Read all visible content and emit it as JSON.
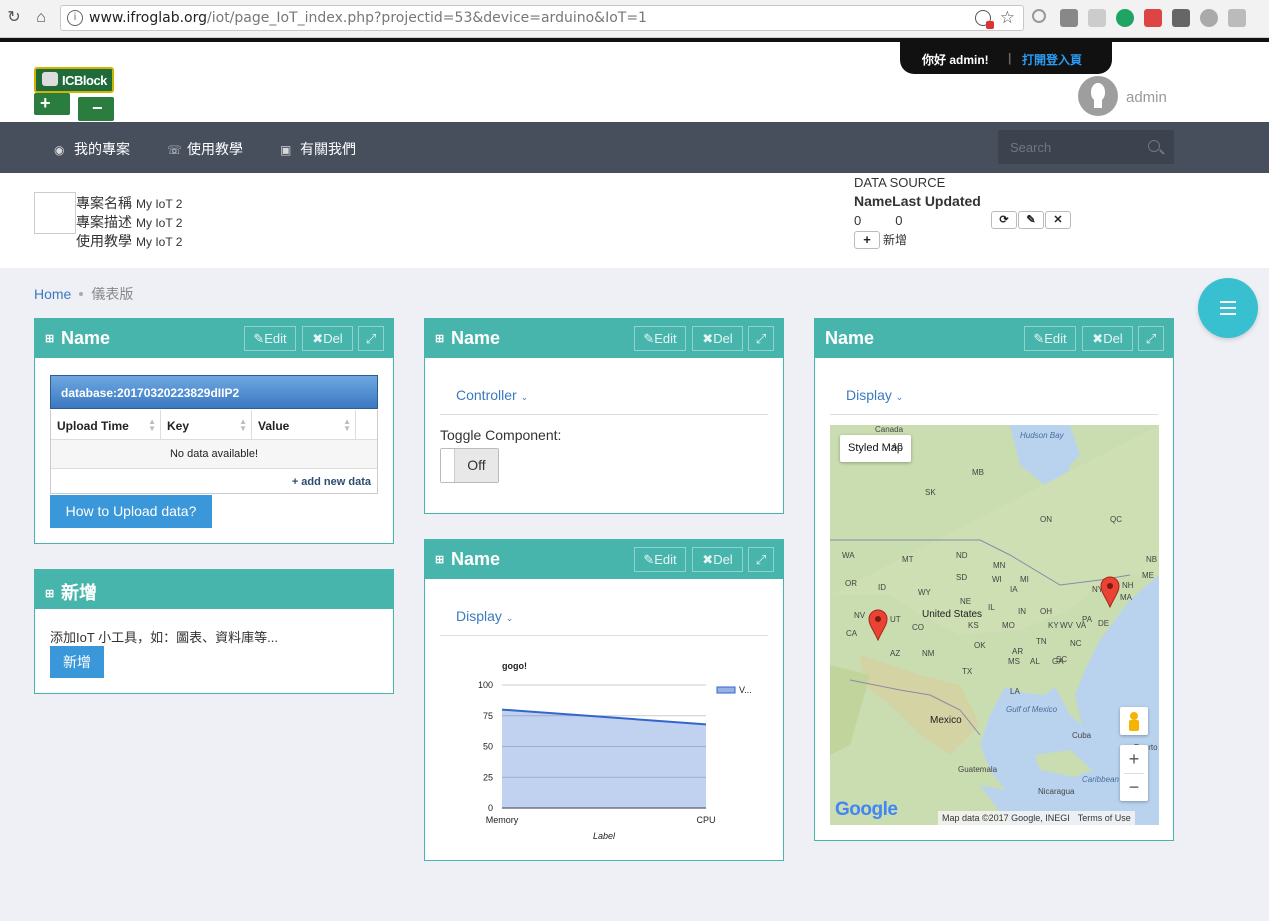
{
  "browser": {
    "url_domain": "www.ifroglab.org",
    "url_path": "/iot/page_IoT_index.php?projectid=53&device=arduino&IoT=1"
  },
  "header": {
    "logo_text": "ICBlock",
    "hello": "你好 admin!",
    "separator": "|",
    "login_link": "打開登入頁",
    "username": "admin"
  },
  "nav": {
    "items": [
      {
        "label": "我的專案",
        "icon": "dashboard-icon"
      },
      {
        "label": "使用教學",
        "icon": "chat-icon"
      },
      {
        "label": "有關我們",
        "icon": "briefcase-icon"
      }
    ],
    "search_placeholder": "Search"
  },
  "project": {
    "rows": [
      {
        "label": "專案名稱",
        "value": "My IoT 2"
      },
      {
        "label": "專案描述",
        "value": "My IoT 2"
      },
      {
        "label": "使用教學",
        "value": "My IoT 2"
      }
    ],
    "datasource": {
      "title": "DATA SOURCE",
      "col_name": "Name",
      "col_updated": "Last Updated",
      "name_value": "0",
      "updated_value": "0",
      "add_label": "新增"
    }
  },
  "breadcrumb": {
    "home": "Home",
    "current": "儀表版"
  },
  "widgets": {
    "table": {
      "title": "Name",
      "edit": "Edit",
      "del": "Del",
      "db_name": "database:20170320223829dIIP2",
      "columns": [
        "Upload Time",
        "Key",
        "Value"
      ],
      "empty": "No data available!",
      "add_data": "+ add new data",
      "how_button": "How to Upload data?"
    },
    "add": {
      "title": "新增",
      "desc": "添加IoT 小工具，如：圖表、資料庫等...",
      "button": "新增"
    },
    "controller": {
      "title": "Name",
      "edit": "Edit",
      "del": "Del",
      "tab": "Controller",
      "toggle_label": "Toggle Component:",
      "toggle_state": "Off"
    },
    "chart": {
      "title": "Name",
      "edit": "Edit",
      "del": "Del",
      "tab": "Display"
    },
    "map": {
      "title": "Name",
      "edit": "Edit",
      "del": "Del",
      "tab": "Display",
      "styled_map": "Styled Map",
      "zoom_in": "+",
      "zoom_out": "−",
      "google": "Google",
      "attribution": "Map data ©2017 Google, INEGI",
      "terms": "Terms of Use",
      "labels": [
        {
          "text": "Canada"
        },
        {
          "text": "Hudson Bay"
        },
        {
          "text": "AB"
        },
        {
          "text": "MB"
        },
        {
          "text": "SK"
        },
        {
          "text": "ON"
        },
        {
          "text": "QC"
        },
        {
          "text": "WA"
        },
        {
          "text": "MT"
        },
        {
          "text": "ND"
        },
        {
          "text": "MN"
        },
        {
          "text": "OR"
        },
        {
          "text": "ID"
        },
        {
          "text": "SD"
        },
        {
          "text": "WY"
        },
        {
          "text": "NE"
        },
        {
          "text": "IA"
        },
        {
          "text": "United States"
        },
        {
          "text": "NV"
        },
        {
          "text": "UT"
        },
        {
          "text": "CO"
        },
        {
          "text": "KS"
        },
        {
          "text": "MO"
        },
        {
          "text": "CA"
        },
        {
          "text": "AZ"
        },
        {
          "text": "NM"
        },
        {
          "text": "OK"
        },
        {
          "text": "TX"
        },
        {
          "text": "AR"
        },
        {
          "text": "MS"
        },
        {
          "text": "AL"
        },
        {
          "text": "GA"
        },
        {
          "text": "LA"
        },
        {
          "text": "TN"
        },
        {
          "text": "NC"
        },
        {
          "text": "SC"
        },
        {
          "text": "KY"
        },
        {
          "text": "VA"
        },
        {
          "text": "WV"
        },
        {
          "text": "IL"
        },
        {
          "text": "IN"
        },
        {
          "text": "OH"
        },
        {
          "text": "PA"
        },
        {
          "text": "MI"
        },
        {
          "text": "WI"
        },
        {
          "text": "NY"
        },
        {
          "text": "MA"
        },
        {
          "text": "DE"
        },
        {
          "text": "ME"
        },
        {
          "text": "NH"
        },
        {
          "text": "NB"
        },
        {
          "text": "Mexico"
        },
        {
          "text": "Gulf of Mexico"
        },
        {
          "text": "Cuba"
        },
        {
          "text": "Guatemala"
        },
        {
          "text": "Nicaragua"
        },
        {
          "text": "Caribbean Sea"
        },
        {
          "text": "Puerto"
        }
      ]
    }
  },
  "chart_data": {
    "type": "area",
    "title": "gogo!",
    "xlabel": "Label",
    "ylabel": "",
    "categories": [
      "Memory",
      "CPU"
    ],
    "series": [
      {
        "name": "V...",
        "values": [
          80,
          68
        ]
      }
    ],
    "ylim": [
      0,
      100
    ],
    "yticks": [
      0,
      25,
      50,
      75,
      100
    ],
    "legend": "right",
    "color": "#3366cc"
  }
}
